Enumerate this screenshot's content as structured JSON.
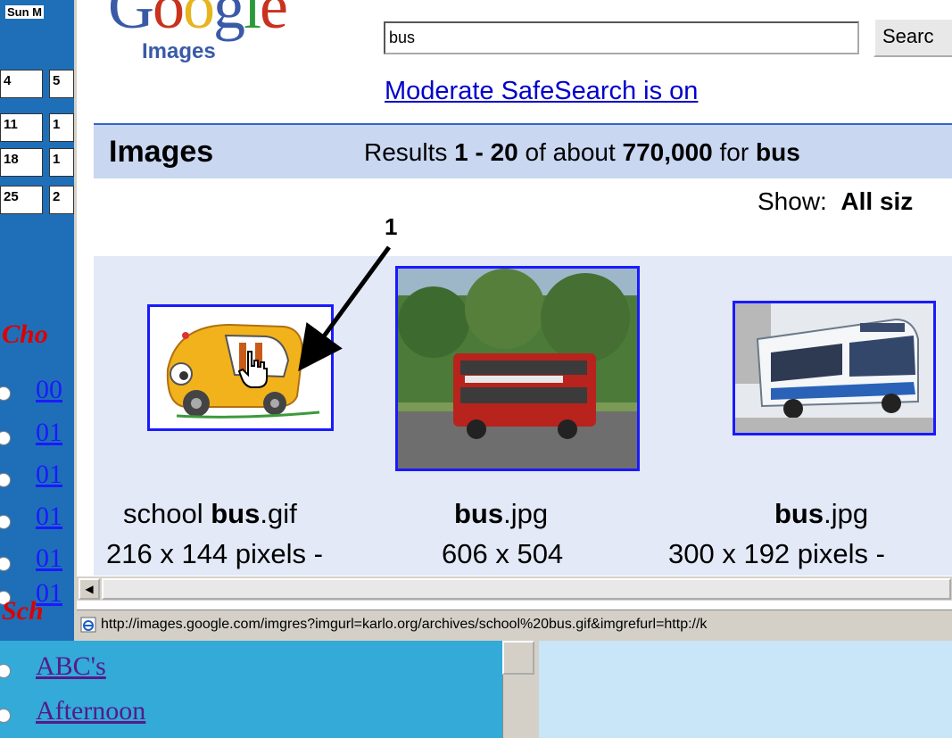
{
  "calendar": {
    "header": "Sun M",
    "rows": [
      [
        "4",
        "5"
      ],
      [
        "11",
        "1"
      ],
      [
        "18",
        "1"
      ],
      [
        "25",
        "2"
      ]
    ]
  },
  "background_page": {
    "section1_label": "Cho",
    "numbered_links": [
      "00",
      "01",
      "01",
      "01",
      "01",
      "01"
    ],
    "section2_label": "Sch",
    "bottom_links": [
      "ABC's",
      "Afternoon"
    ]
  },
  "popup": {
    "logo_word": "Google",
    "logo_subtitle": "Images",
    "search": {
      "value": "bus",
      "button_label": "Searc"
    },
    "safesearch_link": "Moderate SafeSearch is on",
    "results_bar": {
      "heading": "Images",
      "prefix": "Results ",
      "range": "1 - 20",
      "middle": " of about ",
      "count": "770,000",
      "for_text": " for ",
      "query": "bus"
    },
    "show": {
      "label": "Show:",
      "value": "All siz"
    },
    "annotation_number": "1",
    "results": [
      {
        "name_prefix": "school ",
        "name_bold": "bus",
        "name_suffix": ".gif",
        "size": "216 x 144 pixels -"
      },
      {
        "name_prefix": "",
        "name_bold": "bus",
        "name_suffix": ".jpg",
        "size": "606 x 504"
      },
      {
        "name_prefix": "",
        "name_bold": "bus",
        "name_suffix": ".jpg",
        "size": "300 x 192 pixels - "
      }
    ],
    "status_url": "http://images.google.com/imgres?imgurl=karlo.org/archives/school%20bus.gif&imgrefurl=http://k",
    "icons": {
      "status": "ie-page-icon",
      "scroll_left": "left-arrow-icon"
    }
  },
  "colors": {
    "link_blue": "#0000cc",
    "results_bar": "#c9d7f1",
    "thumb_border": "#1a1aff",
    "grid_bg": "#e3e9f7",
    "background_red_label": "#dd0000"
  }
}
